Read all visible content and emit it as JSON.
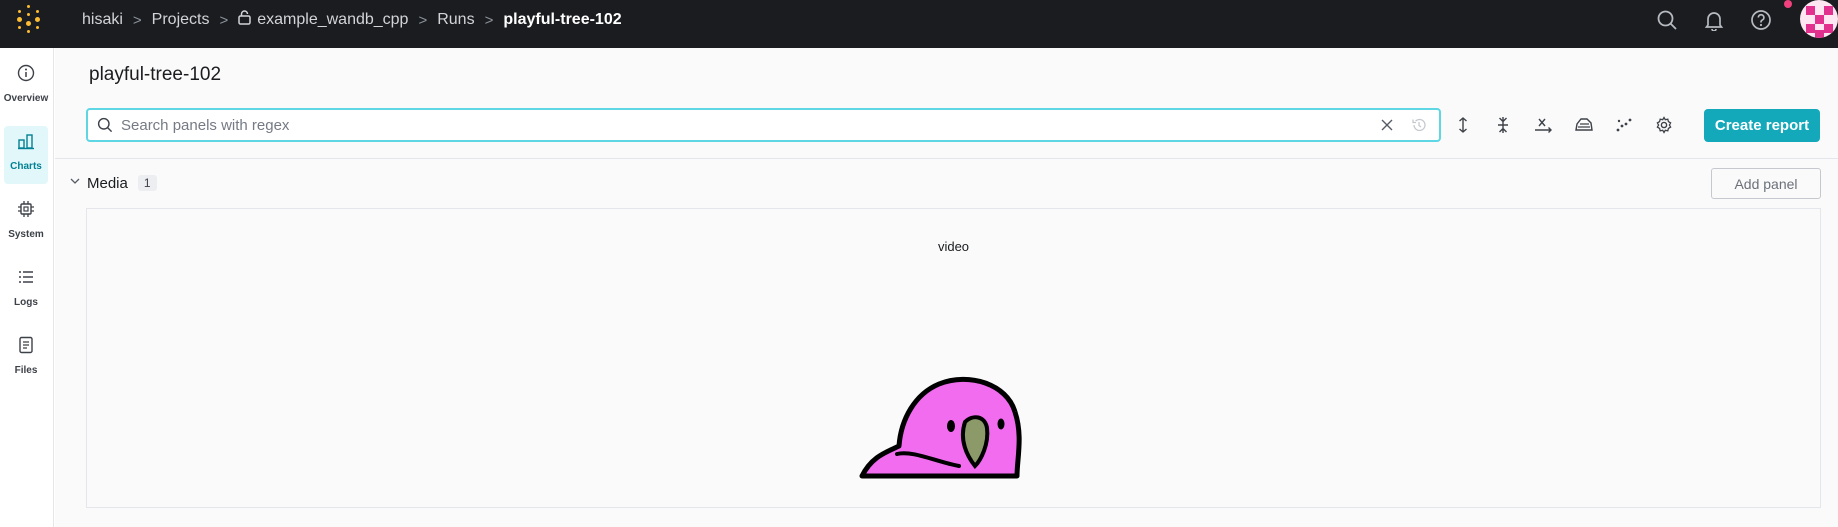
{
  "breadcrumb": {
    "items": [
      "hisaki",
      "Projects",
      "example_wandb_cpp",
      "Runs"
    ],
    "current": "playful-tree-102",
    "separator": ">"
  },
  "topbar": {
    "icons": [
      "search-icon",
      "bell-icon",
      "help-icon"
    ],
    "has_notification": true
  },
  "leftnav": {
    "items": [
      {
        "label": "Overview",
        "icon": "info-icon",
        "active": false
      },
      {
        "label": "Charts",
        "icon": "bar-chart-icon",
        "active": true
      },
      {
        "label": "System",
        "icon": "chip-icon",
        "active": false
      },
      {
        "label": "Logs",
        "icon": "list-icon",
        "active": false
      },
      {
        "label": "Files",
        "icon": "file-icon",
        "active": false
      }
    ]
  },
  "page": {
    "title": "playful-tree-102"
  },
  "search": {
    "placeholder": "Search panels with regex",
    "value": ""
  },
  "toolbar": {
    "icons": [
      "expand-vertical-icon",
      "collapse-icon",
      "x-axis-icon",
      "smoothing-icon",
      "outliers-icon",
      "settings-icon"
    ],
    "create_report_label": "Create report"
  },
  "section": {
    "name": "Media",
    "count": "1",
    "add_panel_label": "Add panel"
  },
  "panel": {
    "title": "video",
    "media": "party-parrot-animation"
  },
  "colors": {
    "accent": "#13a9ba",
    "topbar": "#1a1c1f",
    "logo": "#fcbc32",
    "active_nav_bg": "#e1f7fa",
    "parrot": "#f26cf0"
  }
}
